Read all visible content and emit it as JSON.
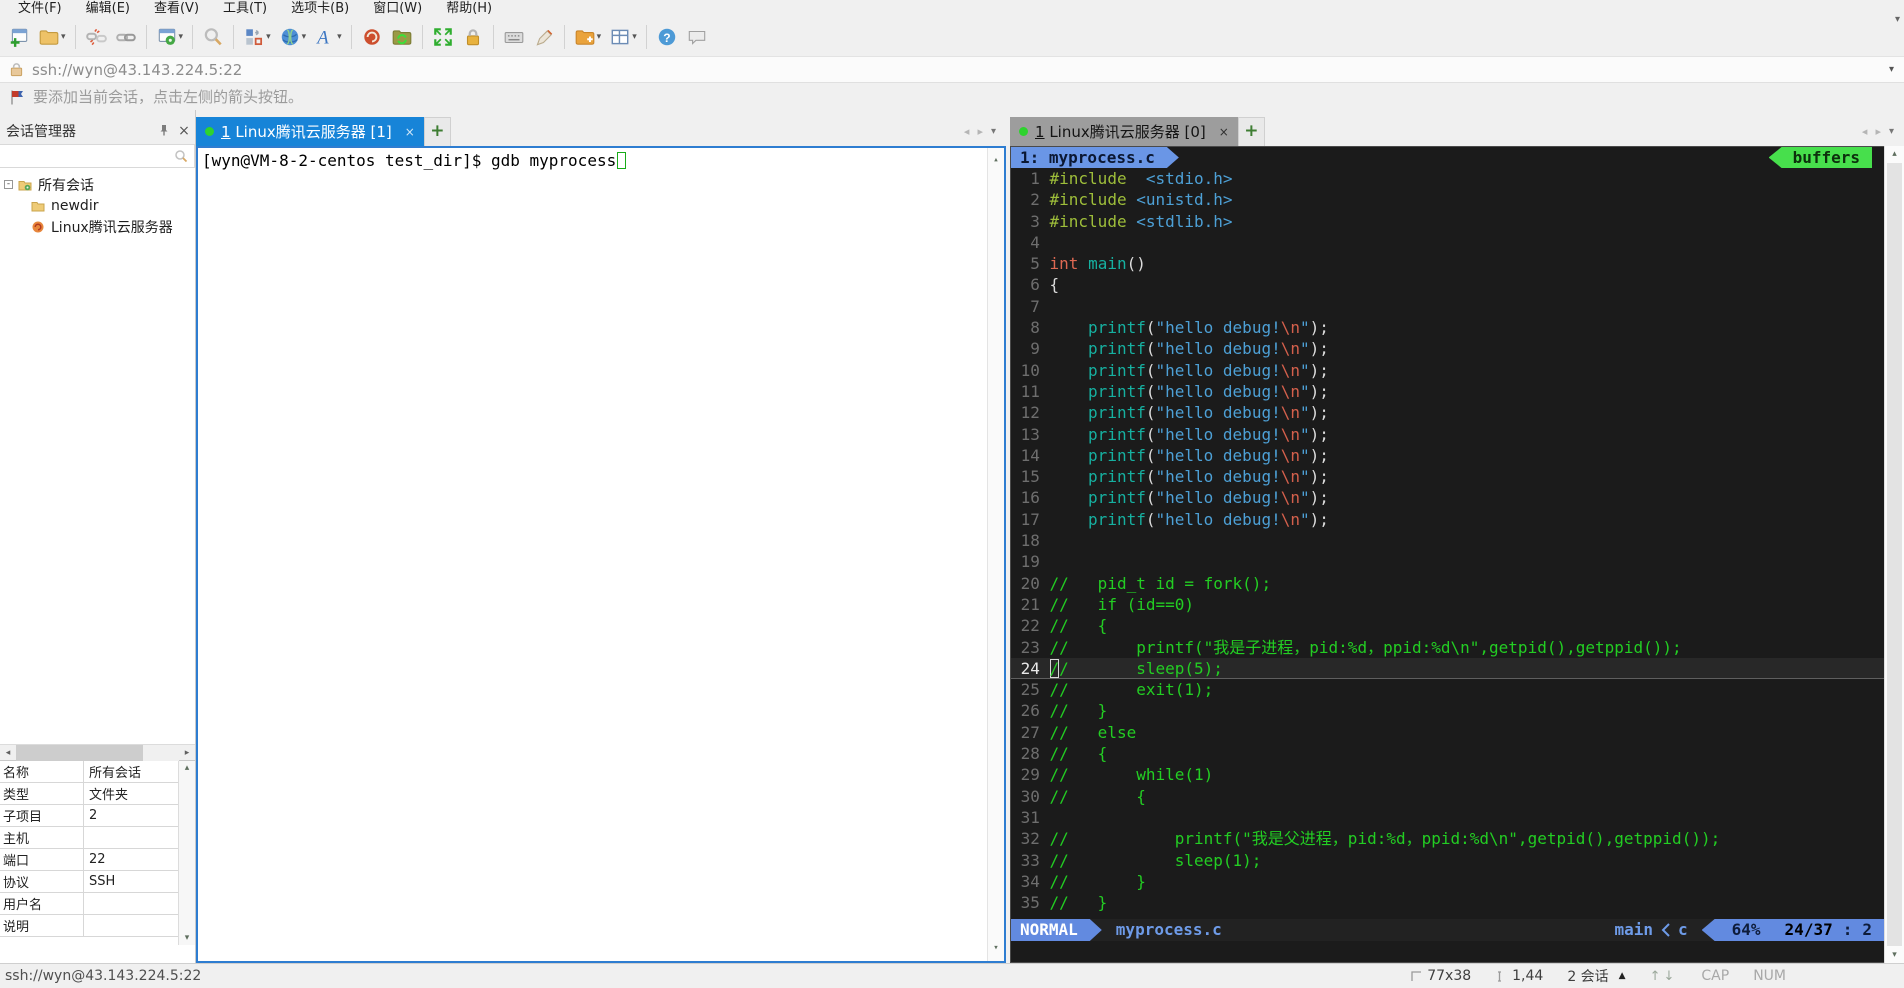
{
  "colors": {
    "accent_blue": "#1784d8",
    "tab_inactive": "#9d9d9d",
    "vim_bg": "#1b1b1b",
    "comment_green": "#23cd23",
    "powerline_blue": "#628ae0",
    "buffers_green": "#47df4c"
  },
  "menubar": {
    "items": [
      "文件(F)",
      "编辑(E)",
      "查看(V)",
      "工具(T)",
      "选项卡(B)",
      "窗口(W)",
      "帮助(H)"
    ]
  },
  "toolbar": {
    "groups": [
      [
        {
          "icon": "new-session"
        },
        {
          "icon": "open-folder",
          "dropdown": true
        }
      ],
      [
        {
          "icon": "disconnect"
        },
        {
          "icon": "reconnect"
        }
      ],
      [
        {
          "icon": "session-properties",
          "dropdown": true
        }
      ],
      [
        {
          "icon": "find"
        }
      ],
      [
        {
          "icon": "layout-compose",
          "dropdown": true
        },
        {
          "icon": "encoding-globe",
          "dropdown": true
        },
        {
          "icon": "font",
          "dropdown": true
        }
      ],
      [
        {
          "icon": "file-transfer"
        },
        {
          "icon": "sync-folder"
        }
      ],
      [
        {
          "icon": "fullscreen"
        },
        {
          "icon": "lock-screen"
        }
      ],
      [
        {
          "icon": "virtual-keyboard"
        },
        {
          "icon": "highlight-pen"
        }
      ],
      [
        {
          "icon": "new-folder",
          "dropdown": true
        },
        {
          "icon": "layout-grid",
          "dropdown": true
        }
      ],
      [
        {
          "icon": "help"
        },
        {
          "icon": "feedback"
        }
      ]
    ]
  },
  "addressbar": {
    "url": "ssh://wyn@43.143.224.5:22"
  },
  "infobar": {
    "text": "要添加当前会话，点击左侧的箭头按钮。"
  },
  "sidebar": {
    "title": "会话管理器",
    "tree": [
      {
        "label": "所有会话",
        "icon": "root-folder",
        "level": 0,
        "expander": "-"
      },
      {
        "label": "newdir",
        "icon": "folder",
        "level": 1
      },
      {
        "label": "Linux腾讯云服务器",
        "icon": "session",
        "level": 1
      }
    ],
    "properties": [
      {
        "key": "名称",
        "value": "所有会话"
      },
      {
        "key": "类型",
        "value": "文件夹"
      },
      {
        "key": "子项目",
        "value": "2"
      },
      {
        "key": "主机",
        "value": ""
      },
      {
        "key": "端口",
        "value": "22"
      },
      {
        "key": "协议",
        "value": "SSH"
      },
      {
        "key": "用户名",
        "value": ""
      },
      {
        "key": "说明",
        "value": ""
      }
    ]
  },
  "left_pane": {
    "tab": {
      "number": "1",
      "label": "Linux腾讯云服务器",
      "suffix": "[1]",
      "close": "×"
    },
    "plus": "+",
    "terminal_line": "[wyn@VM-8-2-centos test_dir]$ gdb myprocess"
  },
  "right_pane": {
    "tab": {
      "number": "1",
      "label": "Linux腾讯云服务器",
      "suffix": "[0]",
      "close": "×"
    },
    "plus": "+",
    "buffer_tab": "1: myprocess.c",
    "buffers_label": "buffers",
    "statusline": {
      "mode": "NORMAL",
      "file": "myprocess.c",
      "branch": "main",
      "filetype": "c",
      "scroll_percent": "64%",
      "line_info": "24/37",
      "separator": ":",
      "col_info": "2"
    },
    "code_lines": [
      {
        "n": 1,
        "t": [
          [
            "p",
            "#include"
          ],
          [
            "x",
            "  "
          ],
          [
            "h",
            "<stdio.h>"
          ]
        ]
      },
      {
        "n": 2,
        "t": [
          [
            "p",
            "#include"
          ],
          [
            "x",
            " "
          ],
          [
            "h",
            "<unistd.h>"
          ]
        ]
      },
      {
        "n": 3,
        "t": [
          [
            "p",
            "#include"
          ],
          [
            "x",
            " "
          ],
          [
            "h",
            "<stdlib.h>"
          ]
        ]
      },
      {
        "n": 4,
        "t": []
      },
      {
        "n": 5,
        "t": [
          [
            "k",
            "int"
          ],
          [
            "x",
            " "
          ],
          [
            "f",
            "main"
          ],
          [
            "x",
            "()"
          ]
        ]
      },
      {
        "n": 6,
        "t": [
          [
            "x",
            "{"
          ]
        ]
      },
      {
        "n": 7,
        "t": []
      },
      {
        "n": 8,
        "t": [
          [
            "x",
            "    "
          ],
          [
            "f",
            "printf"
          ],
          [
            "x",
            "("
          ],
          [
            "s",
            "\"hello debug!"
          ],
          [
            "e",
            "\\n"
          ],
          [
            "s",
            "\""
          ],
          [
            "x",
            ");"
          ]
        ]
      },
      {
        "n": 9,
        "t": [
          [
            "x",
            "    "
          ],
          [
            "f",
            "printf"
          ],
          [
            "x",
            "("
          ],
          [
            "s",
            "\"hello debug!"
          ],
          [
            "e",
            "\\n"
          ],
          [
            "s",
            "\""
          ],
          [
            "x",
            ");"
          ]
        ]
      },
      {
        "n": 10,
        "t": [
          [
            "x",
            "    "
          ],
          [
            "f",
            "printf"
          ],
          [
            "x",
            "("
          ],
          [
            "s",
            "\"hello debug!"
          ],
          [
            "e",
            "\\n"
          ],
          [
            "s",
            "\""
          ],
          [
            "x",
            ");"
          ]
        ]
      },
      {
        "n": 11,
        "t": [
          [
            "x",
            "    "
          ],
          [
            "f",
            "printf"
          ],
          [
            "x",
            "("
          ],
          [
            "s",
            "\"hello debug!"
          ],
          [
            "e",
            "\\n"
          ],
          [
            "s",
            "\""
          ],
          [
            "x",
            ");"
          ]
        ]
      },
      {
        "n": 12,
        "t": [
          [
            "x",
            "    "
          ],
          [
            "f",
            "printf"
          ],
          [
            "x",
            "("
          ],
          [
            "s",
            "\"hello debug!"
          ],
          [
            "e",
            "\\n"
          ],
          [
            "s",
            "\""
          ],
          [
            "x",
            ");"
          ]
        ]
      },
      {
        "n": 13,
        "t": [
          [
            "x",
            "    "
          ],
          [
            "f",
            "printf"
          ],
          [
            "x",
            "("
          ],
          [
            "s",
            "\"hello debug!"
          ],
          [
            "e",
            "\\n"
          ],
          [
            "s",
            "\""
          ],
          [
            "x",
            ");"
          ]
        ]
      },
      {
        "n": 14,
        "t": [
          [
            "x",
            "    "
          ],
          [
            "f",
            "printf"
          ],
          [
            "x",
            "("
          ],
          [
            "s",
            "\"hello debug!"
          ],
          [
            "e",
            "\\n"
          ],
          [
            "s",
            "\""
          ],
          [
            "x",
            ");"
          ]
        ]
      },
      {
        "n": 15,
        "t": [
          [
            "x",
            "    "
          ],
          [
            "f",
            "printf"
          ],
          [
            "x",
            "("
          ],
          [
            "s",
            "\"hello debug!"
          ],
          [
            "e",
            "\\n"
          ],
          [
            "s",
            "\""
          ],
          [
            "x",
            ");"
          ]
        ]
      },
      {
        "n": 16,
        "t": [
          [
            "x",
            "    "
          ],
          [
            "f",
            "printf"
          ],
          [
            "x",
            "("
          ],
          [
            "s",
            "\"hello debug!"
          ],
          [
            "e",
            "\\n"
          ],
          [
            "s",
            "\""
          ],
          [
            "x",
            ");"
          ]
        ]
      },
      {
        "n": 17,
        "t": [
          [
            "x",
            "    "
          ],
          [
            "f",
            "printf"
          ],
          [
            "x",
            "("
          ],
          [
            "s",
            "\"hello debug!"
          ],
          [
            "e",
            "\\n"
          ],
          [
            "s",
            "\""
          ],
          [
            "x",
            ");"
          ]
        ]
      },
      {
        "n": 18,
        "t": []
      },
      {
        "n": 19,
        "t": []
      },
      {
        "n": 20,
        "t": [
          [
            "c",
            "//   pid_t id = fork();"
          ]
        ]
      },
      {
        "n": 21,
        "t": [
          [
            "c",
            "//   if (id==0)"
          ]
        ]
      },
      {
        "n": 22,
        "t": [
          [
            "c",
            "//   {"
          ]
        ]
      },
      {
        "n": 23,
        "t": [
          [
            "c",
            "//       printf(\"我是子进程，pid:%d，ppid:%d\\n\",getpid(),getppid());"
          ]
        ]
      },
      {
        "n": 24,
        "cur": true,
        "t": [
          [
            "cu",
            "/"
          ],
          [
            "c",
            "/       sleep(5);"
          ]
        ]
      },
      {
        "n": 25,
        "t": [
          [
            "c",
            "//       exit(1);"
          ]
        ]
      },
      {
        "n": 26,
        "t": [
          [
            "c",
            "//   }"
          ]
        ]
      },
      {
        "n": 27,
        "t": [
          [
            "c",
            "//   else"
          ]
        ]
      },
      {
        "n": 28,
        "t": [
          [
            "c",
            "//   {"
          ]
        ]
      },
      {
        "n": 29,
        "t": [
          [
            "c",
            "//       while(1)"
          ]
        ]
      },
      {
        "n": 30,
        "t": [
          [
            "c",
            "//       {"
          ]
        ]
      },
      {
        "n": 31,
        "t": []
      },
      {
        "n": 32,
        "t": [
          [
            "c",
            "//           printf(\"我是父进程，pid:%d，ppid:%d\\n\",getpid(),getppid());"
          ]
        ]
      },
      {
        "n": 33,
        "t": [
          [
            "c",
            "//           sleep(1);"
          ]
        ]
      },
      {
        "n": 34,
        "t": [
          [
            "c",
            "//       }"
          ]
        ]
      },
      {
        "n": 35,
        "t": [
          [
            "c",
            "//   }"
          ]
        ]
      }
    ]
  },
  "statusbar": {
    "url": "ssh://wyn@43.143.224.5:22",
    "terminal_size": "77x38",
    "cursor_position": "1,44",
    "session_count": "2 会话",
    "caps": "CAP",
    "num": "NUM"
  }
}
